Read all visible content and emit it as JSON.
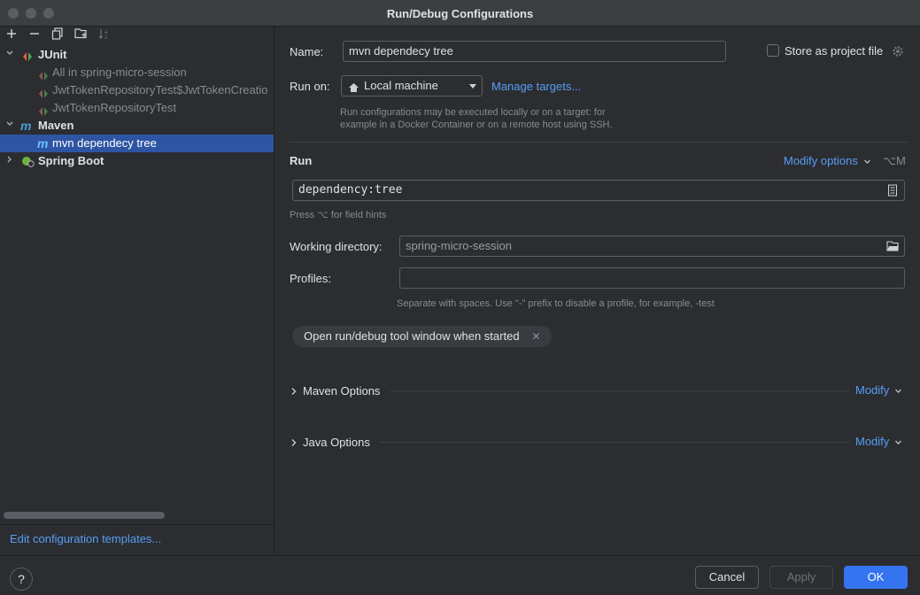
{
  "window": {
    "title": "Run/Debug Configurations"
  },
  "toolbar": {
    "add_icon": "plus-icon",
    "remove_icon": "minus-icon",
    "copy_icon": "copy-icon",
    "folder_icon": "new-folder-icon",
    "sort_icon": "sort-icon"
  },
  "tree": {
    "junit": {
      "label": "JUnit",
      "items": [
        "All in spring-micro-session",
        "JwtTokenRepositoryTest$JwtTokenCreatio",
        "JwtTokenRepositoryTest"
      ]
    },
    "maven": {
      "label": "Maven",
      "items": [
        "mvn dependecy tree"
      ]
    },
    "spring_boot": {
      "label": "Spring Boot"
    },
    "edit_templates": "Edit configuration templates..."
  },
  "form": {
    "name_label": "Name:",
    "name_value": "mvn dependecy tree",
    "store_label": "Store as project file",
    "run_on_label": "Run on:",
    "run_on_value": "Local machine",
    "manage_targets": "Manage targets...",
    "run_on_hint_1": "Run configurations may be executed locally or on a target: for",
    "run_on_hint_2": "example in a Docker Container or on a remote host using SSH.",
    "run_section": "Run",
    "modify_options": "Modify options",
    "modify_shortcut": "⌥M",
    "command_value": "dependency:tree",
    "field_hints": "Press ⌥ for field hints",
    "working_dir_label": "Working directory:",
    "working_dir_value": "spring-micro-session",
    "profiles_label": "Profiles:",
    "profiles_value": "",
    "profiles_hint": "Separate with spaces. Use \"-\" prefix to disable a profile, for example, -test",
    "chip_label": "Open run/debug tool window when started",
    "maven_options": "Maven Options",
    "java_options": "Java Options",
    "modify": "Modify"
  },
  "footer": {
    "help": "?",
    "cancel": "Cancel",
    "apply": "Apply",
    "ok": "OK"
  },
  "colors": {
    "background": "#2b2d30",
    "selection": "#2e55a3",
    "link": "#589df6",
    "primary_button": "#3574f0"
  }
}
